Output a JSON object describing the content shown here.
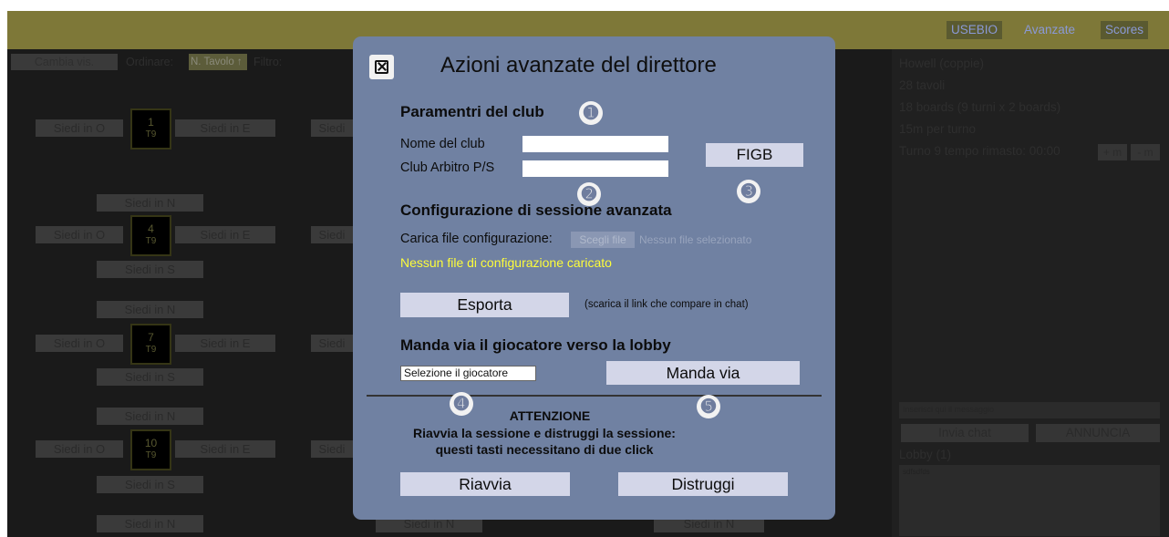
{
  "topbar": {
    "usebio": "USEBIO",
    "avanzate": "Avanzate",
    "scores": "Scores"
  },
  "toolbar": {
    "cambia_vis": "Cambia vis.",
    "ordinare_label": "Ordinare:",
    "ordinare_value": "N. Tavolo ↑",
    "filtro_label": "Filtro:"
  },
  "seats": {
    "o": "Siedi in O",
    "e": "Siedi in E",
    "n": "Siedi in N",
    "s": "Siedi in S",
    "partial": "Siedi"
  },
  "tables": [
    {
      "num": "1",
      "turn": "T9"
    },
    {
      "num": "4",
      "turn": "T9"
    },
    {
      "num": "7",
      "turn": "T9"
    },
    {
      "num": "10",
      "turn": "T9"
    }
  ],
  "right_panel": {
    "movement": "Howell (coppie)",
    "tables": "28 tavoli",
    "boards": "18 boards (9 turni x 2 boards)",
    "per_round": "15m per turno",
    "time_left": "Turno 9 tempo rimasto: 00:00",
    "plus_m": "+ m",
    "minus_m": "- m",
    "message_placeholder": "Inserisci qui il messaggio",
    "send_chat": "Invia chat",
    "announce": "ANNUNCIA",
    "lobby": "Lobby (1)",
    "lobby_content": "sdfsdfds"
  },
  "modal": {
    "title": "Azioni avanzate del direttore",
    "club_heading": "Paramentri del club",
    "club_name_label": "Nome del club",
    "club_referee_label": "Club Arbitro P/S",
    "figb_button": "FIGB",
    "config_heading": "Configurazione di sessione avanzata",
    "upload_label": "Carica file configurazione:",
    "choose_file": "Scegli file",
    "no_file_selected": "Nessun file selezionato",
    "no_config_loaded": "Nessun file di configurazione caricato",
    "export_button": "Esporta",
    "export_note": "(scarica il link che compare in chat)",
    "kick_heading": "Manda via il giocatore verso la lobby",
    "player_select": "Selezione il giocatore",
    "kick_button": "Manda via",
    "attention": "ATTENZIONE",
    "warning_line1": "Riavvia la sessione e distruggi la sessione:",
    "warning_line2": "questi tasti necessitano di due click",
    "restart_button": "Riavvia",
    "destroy_button": "Distruggi"
  },
  "badges": [
    "➊",
    "➋",
    "➌",
    "➍",
    "➎"
  ],
  "colors": {
    "modal_bg": "#7081a2",
    "topbar": "#7e7838",
    "warning_yellow": "#fdfd3a",
    "button_bg": "#d3d6e8"
  }
}
